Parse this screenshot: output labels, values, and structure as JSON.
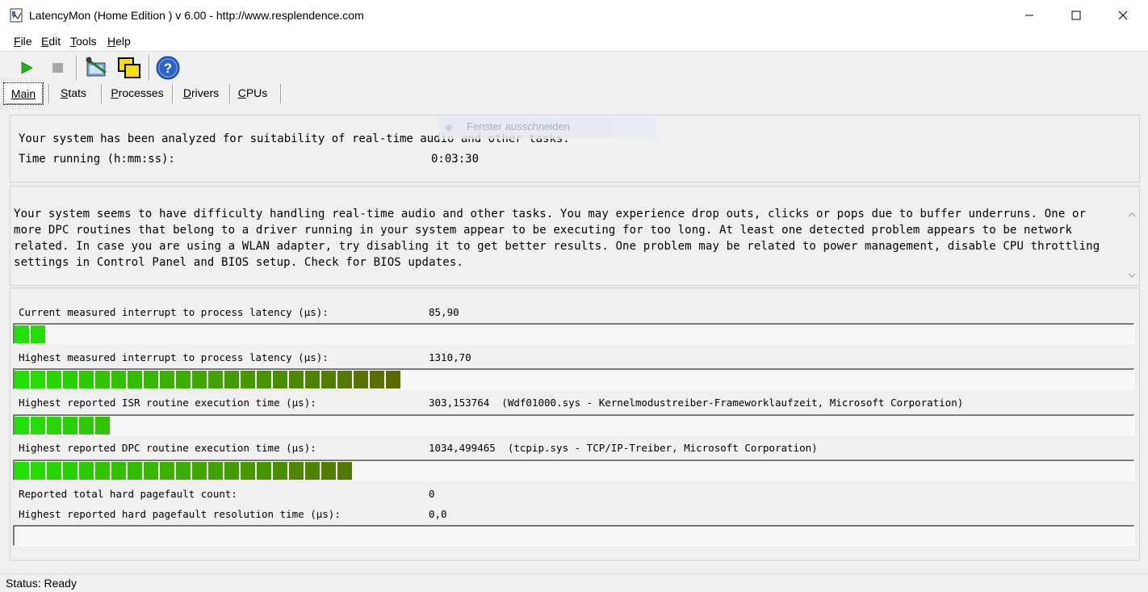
{
  "window": {
    "title": "LatencyMon  (Home Edition )  v 6.00 - http://www.resplendence.com"
  },
  "menu": [
    {
      "label": "File",
      "accel": "F",
      "rest": "ile"
    },
    {
      "label": "Edit",
      "accel": "E",
      "rest": "dit"
    },
    {
      "label": "Tools",
      "accel": "T",
      "rest": "ools"
    },
    {
      "label": "Help",
      "accel": "H",
      "rest": "elp"
    }
  ],
  "tabs": [
    {
      "label": "Main",
      "accel": "M",
      "rest": "ain"
    },
    {
      "label": "Stats",
      "accel": "S",
      "rest": "tats"
    },
    {
      "label": "Processes",
      "accel": "P",
      "rest": "rocesses"
    },
    {
      "label": "Drivers",
      "accel": "D",
      "rest": "rivers"
    },
    {
      "label": "CPUs",
      "accel": "C",
      "rest": "PUs"
    }
  ],
  "overlay_hint": "Fenster ausschneiden",
  "summary": {
    "line1": "Your system has been analyzed for suitability of real-time audio and other tasks.",
    "time_label": "Time running (h:mm:ss):",
    "time_value": "0:03:30"
  },
  "analysis_text": "Your system seems to have difficulty handling real-time audio and other tasks. You may experience drop outs, clicks or pops due to buffer underruns. One or more DPC routines that belong to a driver running in your system appear to be executing for too long. At least one detected problem appears to be network related. In case you are using a WLAN adapter, try disabling it to get better results. One problem may be related to power management, disable CPU throttling settings in Control Panel and BIOS setup. Check for BIOS updates.",
  "metrics": [
    {
      "label": "Current measured interrupt to process latency (µs):",
      "value": "85,90",
      "bar_segments": 2
    },
    {
      "label": "Highest measured interrupt to process latency (µs):",
      "value": "1310,70",
      "bar_segments": 24
    },
    {
      "label": "Highest reported ISR routine execution time (µs):",
      "value": "303,153764  (Wdf01000.sys - Kernelmodustreiber-Frameworklaufzeit, Microsoft Corporation)",
      "bar_segments": 6
    },
    {
      "label": "Highest reported DPC routine execution time (µs):",
      "value": "1034,499465  (tcpip.sys - TCP/IP-Treiber, Microsoft Corporation)",
      "bar_segments": 21
    },
    {
      "label": "Reported total hard pagefault count:",
      "value": "0"
    },
    {
      "label": "Highest reported hard pagefault resolution time (µs):",
      "value": "0,0",
      "bar_segments": 0
    }
  ],
  "status": {
    "text": "Status: Ready"
  },
  "colors": {
    "bar_start": "#22e000",
    "bar_end": "#5c6a00"
  },
  "icons": [
    "play-icon",
    "stop-icon",
    "driver-tool-icon",
    "window-copy-icon",
    "help-icon"
  ]
}
